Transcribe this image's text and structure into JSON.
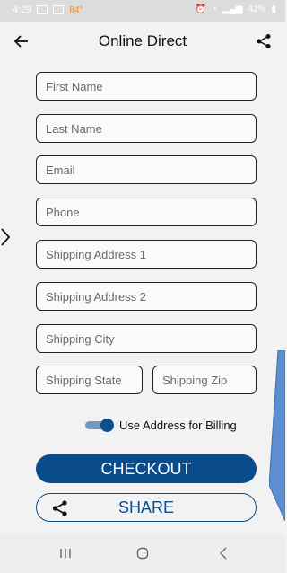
{
  "status_bar": {
    "time": "4:29",
    "temperature": "84°",
    "battery": "42%"
  },
  "app_bar": {
    "title": "Online Direct"
  },
  "form": {
    "first_name_placeholder": "First Name",
    "last_name_placeholder": "Last Name",
    "email_placeholder": "Email",
    "phone_placeholder": "Phone",
    "address1_placeholder": "Shipping Address 1",
    "address2_placeholder": "Shipping Address 2",
    "city_placeholder": "Shipping City",
    "state_placeholder": "Shipping State",
    "zip_placeholder": "Shipping Zip"
  },
  "billing_toggle": {
    "label": "Use Address for Billing",
    "checked": true
  },
  "buttons": {
    "checkout_label": "CHECKOUT",
    "share_label": "SHARE"
  },
  "colors": {
    "accent": "#0a4c8b",
    "background": "#f2f2f2"
  },
  "icons": {
    "back": "arrow-left-icon",
    "share": "share-icon"
  }
}
